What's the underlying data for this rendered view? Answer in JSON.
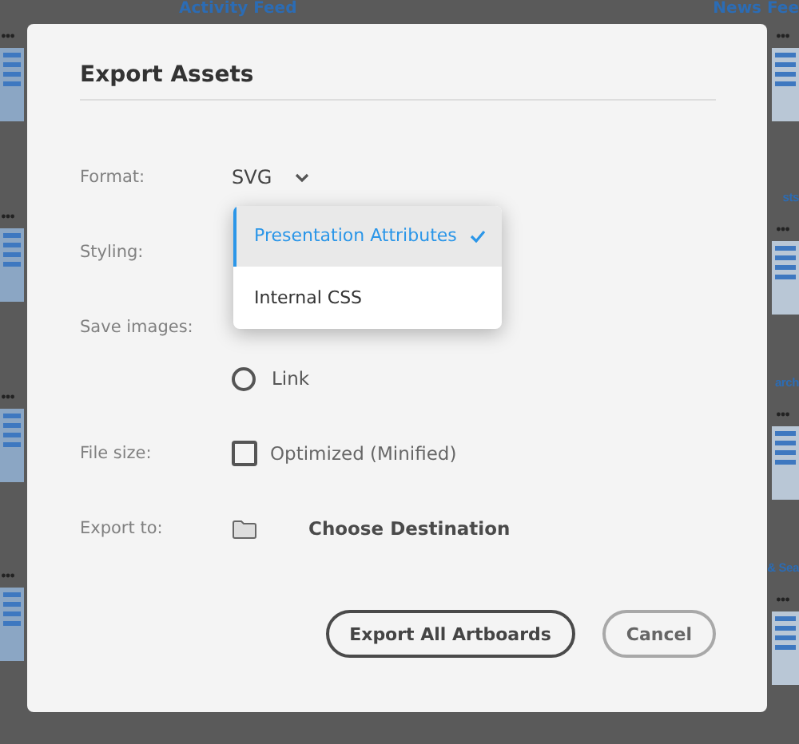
{
  "background": {
    "top_titles": [
      {
        "title": "Activity Feed"
      },
      {
        "title": "News Fee"
      }
    ],
    "right_titles": [
      {
        "title": "sts"
      },
      {
        "title": "arch"
      },
      {
        "title": "& Sea"
      }
    ]
  },
  "dialog": {
    "title": "Export Assets",
    "fields": [
      {
        "kind": "select",
        "label": "Format:",
        "value": "SVG"
      },
      {
        "kind": "dropdown",
        "label": "Styling:"
      },
      {
        "kind": "radio",
        "label": "Save images:",
        "options": [
          {
            "label": "Link",
            "selected": false
          }
        ]
      },
      {
        "kind": "checkbox",
        "label": "File size:",
        "option": "Optimized (Minified)",
        "checked": false
      },
      {
        "kind": "destination",
        "label": "Export to:",
        "value": "Choose Destination"
      }
    ],
    "dropdown_menu": [
      {
        "label": "Presentation Attributes",
        "selected": true
      },
      {
        "label": "Internal CSS",
        "selected": false
      }
    ],
    "buttons": [
      {
        "label": "Export All Artboards",
        "kind": "primary"
      },
      {
        "label": "Cancel",
        "kind": "secondary"
      }
    ]
  }
}
